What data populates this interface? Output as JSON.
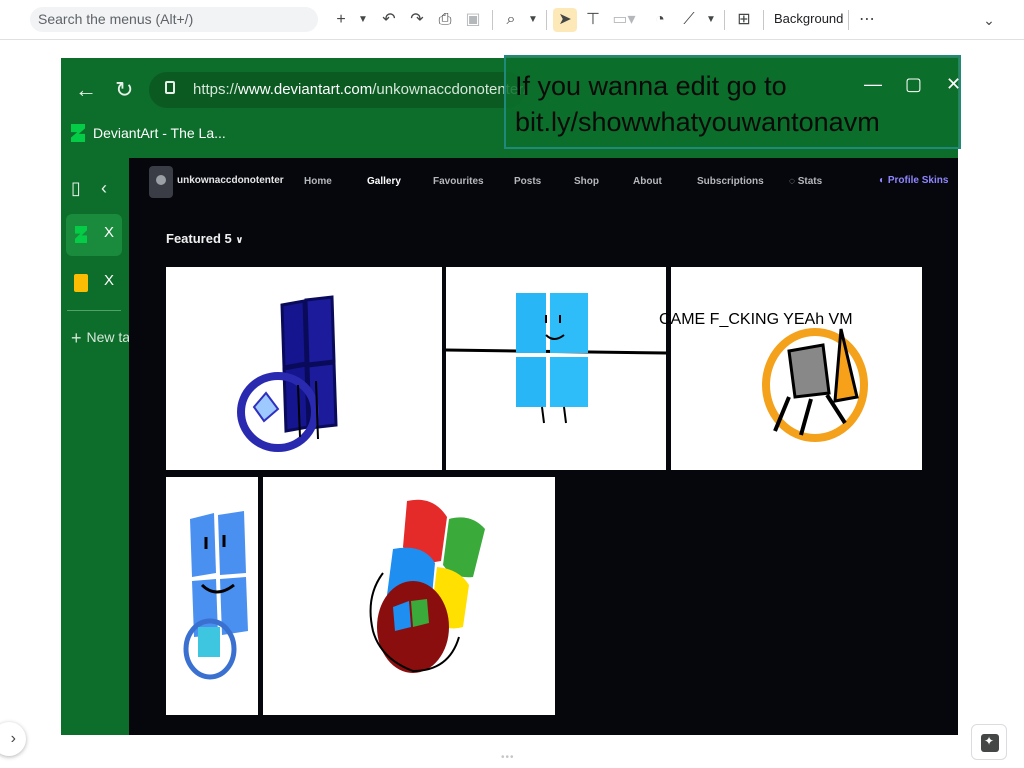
{
  "toolbar": {
    "search_placeholder": "Search the menus (Alt+/)",
    "icons": [
      "plus-icon",
      "dropdown-icon",
      "undo-icon",
      "redo-icon",
      "print-icon",
      "paint-format-icon",
      "zoom-icon",
      "dropdown-icon",
      "select-cursor-icon",
      "text-box-icon",
      "image-icon",
      "shape-icon",
      "line-icon",
      "comment-add-icon",
      "more-icon",
      "chevron-down-icon"
    ],
    "background_label": "Background",
    "more_label": "⋯"
  },
  "browser": {
    "url_prefix": "https://",
    "url_host": "www.deviantart.com",
    "url_path": "/unkownaccdonotenter/galler",
    "tab_title": "DeviantArt - The La...",
    "tab_close": "X",
    "tab2_close": "X",
    "new_tab_label": "New tab"
  },
  "deviantart": {
    "username": "unkownaccdonotenter",
    "nav": [
      "Home",
      "Gallery",
      "Favourites",
      "Posts",
      "Shop",
      "About",
      "Subscriptions",
      "Stats"
    ],
    "profile_skins": "Profile Skins",
    "featured_label": "Featured",
    "featured_count": "5"
  },
  "overlays": {
    "edit_line1": "If you wanna edit go to",
    "edit_line2": "bit.ly/showwhatyouwantonavm",
    "caption": "CAME F_CKING YEAh VM"
  },
  "colors": {
    "browser_green": "#0c6e2a",
    "da_background": "#06070d",
    "accent_purple": "#8f86ff"
  }
}
